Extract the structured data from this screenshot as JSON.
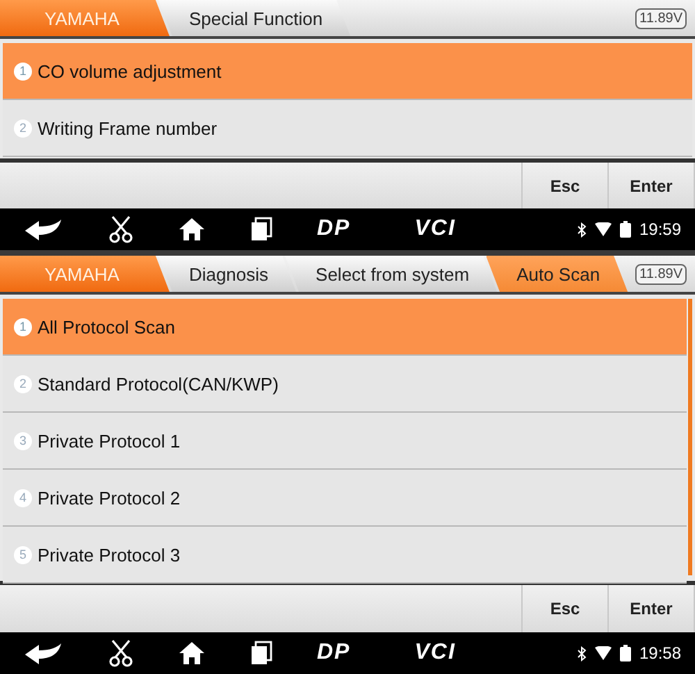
{
  "screens": [
    {
      "breadcrumbs": [
        {
          "label": "YAMAHA",
          "kind": "brand"
        },
        {
          "label": "Special Function",
          "kind": "step",
          "selected": false
        }
      ],
      "voltage": "11.89V",
      "items": [
        {
          "number": "1",
          "label": "CO volume adjustment",
          "selected": true
        },
        {
          "number": "2",
          "label": "Writing Frame number",
          "selected": false
        }
      ],
      "scrollbar": false,
      "buttons": [
        "Esc",
        "Enter"
      ],
      "nav": {
        "dp": "DP",
        "vci": "VCI",
        "time": "19:59"
      }
    },
    {
      "breadcrumbs": [
        {
          "label": "YAMAHA",
          "kind": "brand"
        },
        {
          "label": "Diagnosis",
          "kind": "step",
          "selected": false
        },
        {
          "label": "Select from system",
          "kind": "step",
          "selected": false
        },
        {
          "label": "Auto Scan",
          "kind": "step",
          "selected": true
        }
      ],
      "voltage": "11.89V",
      "items": [
        {
          "number": "1",
          "label": "All Protocol Scan",
          "selected": true
        },
        {
          "number": "2",
          "label": "Standard Protocol(CAN/KWP)",
          "selected": false
        },
        {
          "number": "3",
          "label": "Private Protocol 1",
          "selected": false
        },
        {
          "number": "4",
          "label": "Private Protocol 2",
          "selected": false
        },
        {
          "number": "5",
          "label": "Private Protocol 3",
          "selected": false
        }
      ],
      "scrollbar": true,
      "buttons": [
        "Esc",
        "Enter"
      ],
      "nav": {
        "dp": "DP",
        "vci": "VCI",
        "time": "19:58"
      }
    }
  ]
}
